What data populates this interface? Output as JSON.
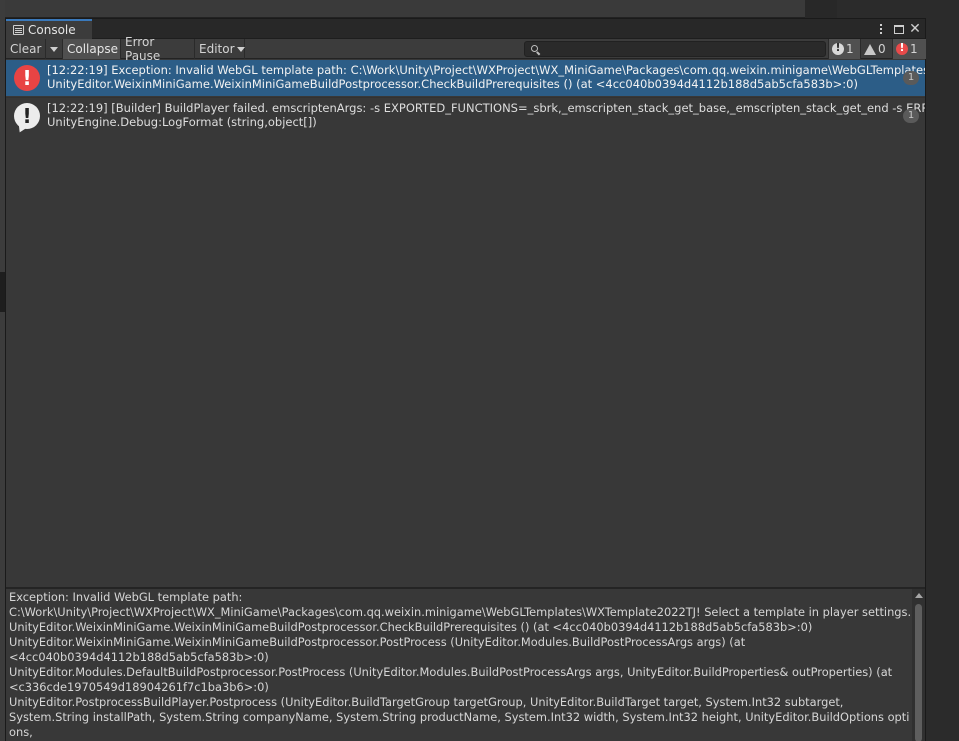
{
  "window": {
    "tab_title": "Console"
  },
  "toolbar": {
    "clear": "Clear",
    "collapse": "Collapse",
    "error_pause": "Error Pause",
    "editor": "Editor",
    "search_value": "",
    "counts": {
      "info": "1",
      "warn": "0",
      "error": "1"
    }
  },
  "entries": [
    {
      "type": "error",
      "line1": "[12:22:19] Exception: Invalid WebGL template path: C:\\Work\\Unity\\Project\\WXProject\\WX_MiniGame\\Packages\\com.qq.weixin.minigame\\WebGLTemplates\\WX",
      "line2": "UnityEditor.WeixinMiniGame.WeixinMiniGameBuildPostprocessor.CheckBuildPrerequisites () (at <4cc040b0394d4112b188d5ab5cfa583b>:0)",
      "count": "1",
      "selected": true
    },
    {
      "type": "info",
      "line1": "[12:22:19] [Builder] BuildPlayer failed. emscriptenArgs: -s EXPORTED_FUNCTIONS=_sbrk,_emscripten_stack_get_base,_emscripten_stack_get_end -s ERROR_O",
      "line2": "UnityEngine.Debug:LogFormat (string,object[])",
      "count": "1",
      "selected": false
    }
  ],
  "detail": {
    "text": "Exception: Invalid WebGL template path:\nC:\\Work\\Unity\\Project\\WXProject\\WX_MiniGame\\Packages\\com.qq.weixin.minigame\\WebGLTemplates\\WXTemplate2022TJ! Select a template in player settings.\nUnityEditor.WeixinMiniGame.WeixinMiniGameBuildPostprocessor.CheckBuildPrerequisites () (at <4cc040b0394d4112b188d5ab5cfa583b>:0)\nUnityEditor.WeixinMiniGame.WeixinMiniGameBuildPostprocessor.PostProcess (UnityEditor.Modules.BuildPostProcessArgs args) (at\n<4cc040b0394d4112b188d5ab5cfa583b>:0)\nUnityEditor.Modules.DefaultBuildPostprocessor.PostProcess (UnityEditor.Modules.BuildPostProcessArgs args, UnityEditor.BuildProperties& outProperties) (at\n<c336cde1970549d18904261f7c1ba3b6>:0)\nUnityEditor.PostprocessBuildPlayer.Postprocess (UnityEditor.BuildTargetGroup targetGroup, UnityEditor.BuildTarget target, System.Int32 subtarget,\nSystem.String installPath, System.String companyName, System.String productName, System.Int32 width, System.Int32 height, UnityEditor.BuildOptions options,\nUnityEditor.RuntimeClassRegistry usedClassRegistry, UnityEditor.Build.Reporting.BuildReport report) (at <c336cde1970549d18904261f7c1ba3b6>:0)"
  }
}
